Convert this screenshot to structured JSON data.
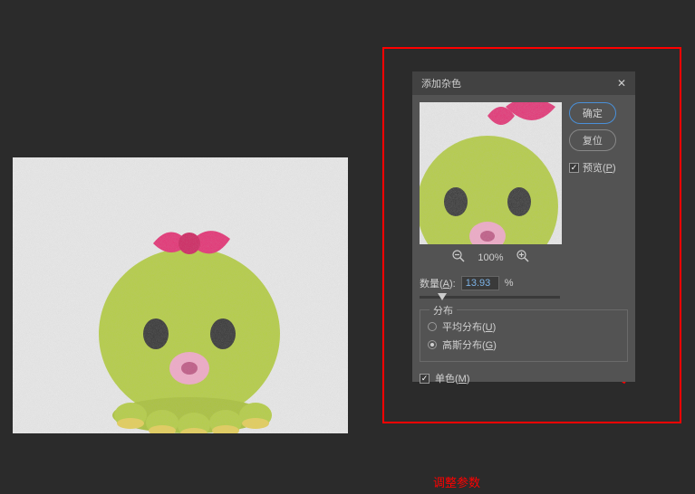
{
  "dialog": {
    "title": "添加杂色",
    "ok_button": "确定",
    "reset_button": "复位",
    "preview_label": "预览(P)",
    "preview_checked": true,
    "zoom_level": "100%",
    "amount_label": "数量(A):",
    "amount_value": "13.93",
    "amount_unit": "%",
    "distribution": {
      "group_label": "分布",
      "uniform_label": "平均分布(U)",
      "gaussian_label": "高斯分布(G)",
      "selected": "gaussian"
    },
    "mono_label": "单色(M)",
    "mono_checked": true
  },
  "caption": "调整参数",
  "colors": {
    "highlight_red": "#ff0000",
    "dialog_bg": "#535353",
    "input_text": "#7db4e8"
  }
}
